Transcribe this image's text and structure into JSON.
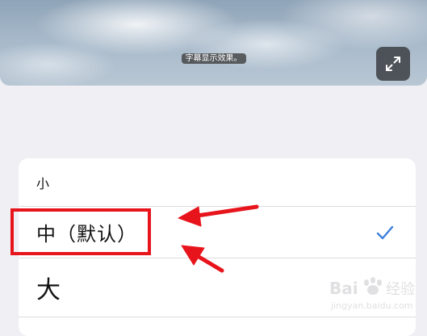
{
  "preview": {
    "subtitle_sample": "字幕显示效果。",
    "expand_icon": "expand-icon"
  },
  "font_size_options": [
    {
      "label": "小",
      "selected": false
    },
    {
      "label": "中（默认）",
      "selected": true
    },
    {
      "label": "大",
      "selected": false
    }
  ],
  "selected_check_icon": "checkmark-icon",
  "colors": {
    "background": "#efeff4",
    "card": "#ffffff",
    "check": "#3b7fd9",
    "annotation_red": "#e8141c"
  },
  "watermark": {
    "brand": "Baidu经验",
    "url": "jingyan.baidu.com"
  }
}
